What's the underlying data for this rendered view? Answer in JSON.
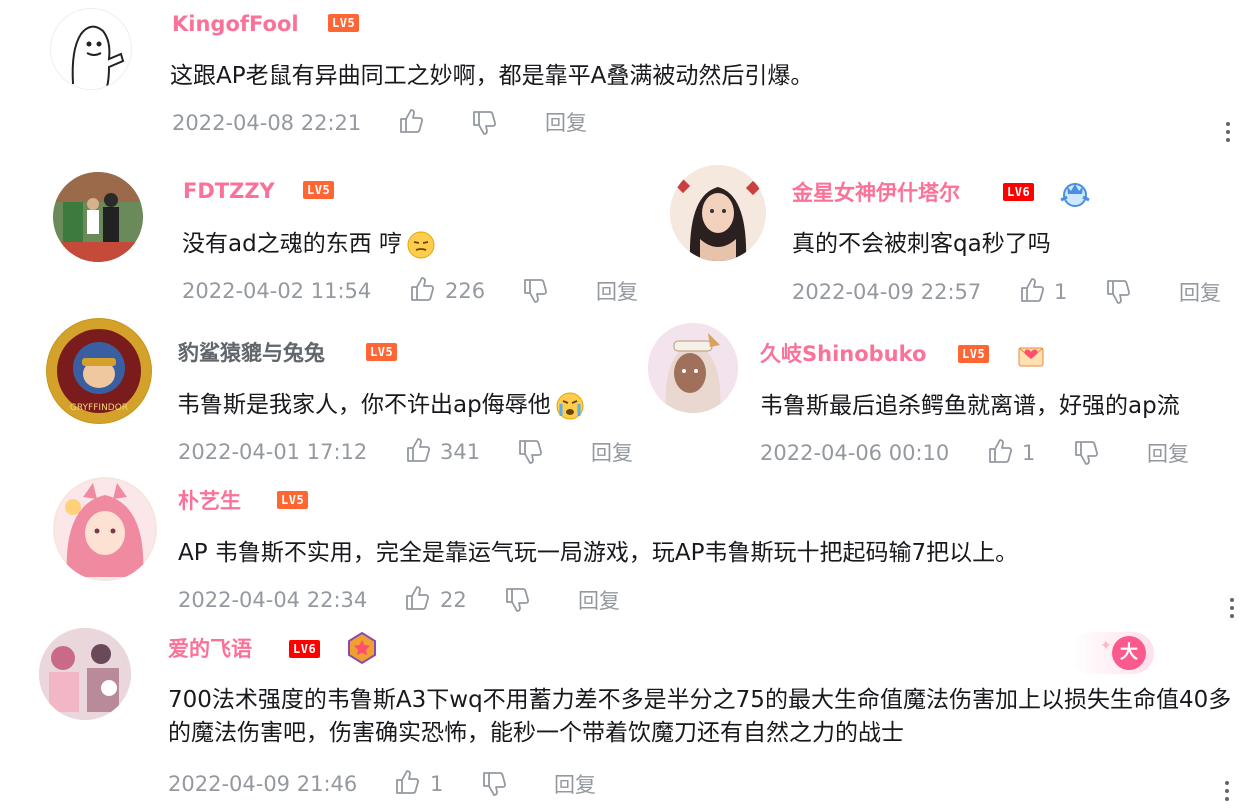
{
  "comments": [
    {
      "user": "KingofFool",
      "level": "LV5",
      "text": "这跟AP老鼠有异曲同工之妙啊，都是靠平A叠满被动然后引爆。",
      "date": "2022-04-08 22:21",
      "likes": "",
      "reply": "回复"
    },
    {
      "user": "FDTZZY",
      "level": "LV5",
      "text": "没有ad之魂的东西 哼",
      "date": "2022-04-02 11:54",
      "likes": "226",
      "reply": "回复"
    },
    {
      "user": "金星女神伊什塔尔",
      "level": "LV6",
      "text": "真的不会被刺客qa秒了吗",
      "date": "2022-04-09 22:57",
      "likes": "1",
      "reply": "回复"
    },
    {
      "user": "豹鲨猿貔与兔兔",
      "level": "LV5",
      "text": "韦鲁斯是我家人，你不许出ap侮辱他",
      "date": "2022-04-01 17:12",
      "likes": "341",
      "reply": "回复"
    },
    {
      "user": "久岐Shinobuko",
      "level": "LV5",
      "text": "韦鲁斯最后追杀鳄鱼就离谱，好强的ap流",
      "date": "2022-04-06 00:10",
      "likes": "1",
      "reply": "回复"
    },
    {
      "user": "朴艺生",
      "level": "LV5",
      "text": "AP 韦鲁斯不实用，完全是靠运气玩一局游戏，玩AP韦鲁斯玩十把起码输7把以上。",
      "date": "2022-04-04 22:34",
      "likes": "22",
      "reply": "回复"
    },
    {
      "user": "爱的飞语",
      "level": "LV6",
      "text": "700法术强度的韦鲁斯A3下wq不用蓄力差不多是半分之75的最大生命值魔法伤害加上以损失生命值40多的魔法伤害吧，伤害确实恐怖，能秒一个带着饮魔刀还有自然之力的战士",
      "date": "2022-04-09 21:46",
      "likes": "1",
      "reply": "回复"
    }
  ],
  "floating_badge": "大",
  "colors": {
    "username": "#fb7299",
    "lv5": "#ff6633",
    "lv6": "#ff0000",
    "meta": "#9499a0"
  }
}
